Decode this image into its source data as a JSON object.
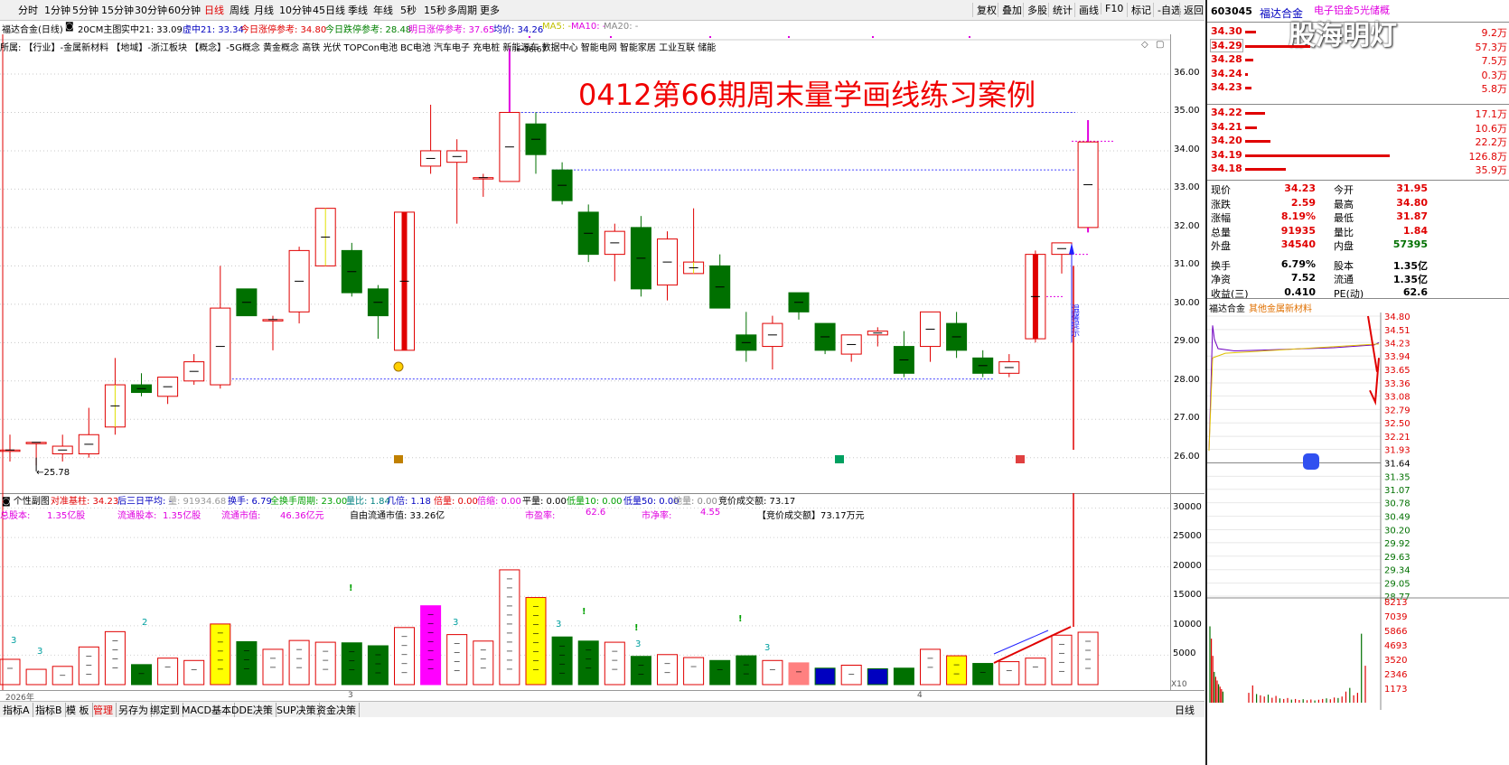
{
  "toolbar": {
    "periods": [
      "分时",
      "1分钟",
      "5分钟",
      "15分钟",
      "30分钟",
      "60分钟",
      "日线",
      "周线",
      "月线",
      "10分钟",
      "45日线",
      "季线",
      "年线",
      "5秒",
      "15秒",
      "多周期",
      "更多"
    ],
    "active": "日线",
    "right_buttons": [
      "复权",
      "叠加",
      "多股",
      "统计",
      "画线",
      "F10",
      "标记",
      "-自选",
      "返回"
    ]
  },
  "info": {
    "title": "福达合金(日线)",
    "main": "20CM主图",
    "shizhong": "实中21: 33.09",
    "xuzhong": "虚中21: 33.34",
    "today_limit": "今日涨停参考: 34.80",
    "today_down": "今日跌停参考: 28.48",
    "tomorrow_limit": "明日涨停参考: 37.65",
    "avg": "均价: 34.26",
    "ma5": "MA5: -",
    "ma10": "MA10: -",
    "ma20": "MA20: -"
  },
  "suoshu": "所属:   【行业】-金属新材料  【地域】-浙江板块    【概念】-5G概念 黄金概念 高铁 光伏 TOPCon电池 BC电池 汽车电子 充电桩 新能源车 数据中心 智能电网 智能家居 工业互联 储能",
  "overlay_title": "0412第66期周末量学画线练习案例",
  "annot": {
    "low": "25.78",
    "high": "36.67",
    "side_note": "温馨提示"
  },
  "axis_prices": [
    "36.00",
    "35.00",
    "34.00",
    "33.00",
    "32.00",
    "31.00",
    "30.00",
    "29.00",
    "28.00",
    "27.00",
    "26.00"
  ],
  "vol_axis": [
    "30000",
    "25000",
    "20000",
    "15000",
    "10000",
    "5000"
  ],
  "sub": {
    "name": "个性副图",
    "line1": [
      "对准基柱: 34.23",
      "后三日平均: -",
      "量: 91934.68",
      "换手: 6.79",
      "全换手周期: 23.00",
      "量比: 1.84",
      "几倍: 1.18",
      "倍量: 0.00",
      "倍缩: 0.00",
      "平量: 0.00",
      "低量10: 0.00",
      "低量50: 0.00",
      "地量: 0.00",
      "竞价成交额: 73.17"
    ],
    "line2": [
      "总股本:",
      "1.35亿股",
      "流通股本:",
      "1.35亿股",
      "流通市值:",
      "46.36亿元",
      "自由流通市值: 33.26亿",
      "市盈率:",
      "62.6",
      "市净率:",
      "4.55",
      "【竞价成交额】73.17万元"
    ]
  },
  "x_labels": [
    "2026年",
    "3",
    "4"
  ],
  "x_unit": "X10",
  "bottom_tabs": [
    "指标A",
    "指标B",
    "模 板",
    "管理",
    "另存为",
    "绑定到",
    "MACD基本",
    "DDE决策",
    "SUP决策",
    "资金决策"
  ],
  "bottom_right": "日线",
  "quote": {
    "code": "603045",
    "name": "福达合金",
    "tag": "电子铝金5光储概",
    "watermark": "股海明灯",
    "asks": [
      {
        "p": "34.30",
        "v": "9.2万"
      },
      {
        "p": "34.29",
        "v": "57.3万"
      },
      {
        "p": "34.28",
        "v": "7.5万"
      },
      {
        "p": "34.24",
        "v": "0.3万"
      },
      {
        "p": "34.23",
        "v": "5.8万"
      }
    ],
    "bids": [
      {
        "p": "34.22",
        "v": "17.1万"
      },
      {
        "p": "34.21",
        "v": "10.6万"
      },
      {
        "p": "34.20",
        "v": "22.2万"
      },
      {
        "p": "34.19",
        "v": "126.8万"
      },
      {
        "p": "34.18",
        "v": "35.9万"
      }
    ],
    "stats": [
      [
        "现价",
        "34.23",
        "今开",
        "31.95"
      ],
      [
        "涨跌",
        "2.59",
        "最高",
        "34.80"
      ],
      [
        "涨幅",
        "8.19%",
        "最低",
        "31.87"
      ],
      [
        "总量",
        "91935",
        "量比",
        "1.84"
      ],
      [
        "外盘",
        "34540",
        "内盘",
        "57395"
      ],
      [
        "换手",
        "6.79%",
        "股本",
        "1.35亿"
      ],
      [
        "净资",
        "7.52",
        "流通",
        "1.35亿"
      ],
      [
        "收益(三)",
        "0.410",
        "PE(动)",
        "62.6"
      ]
    ],
    "mini_title": "福达合金",
    "mini_sector": "其他金属新材料",
    "mini_prices": [
      "34.80",
      "34.51",
      "34.23",
      "33.94",
      "33.65",
      "33.36",
      "33.08",
      "32.79",
      "32.50",
      "32.21",
      "31.93",
      "31.64",
      "31.35",
      "31.07",
      "30.78",
      "30.49",
      "30.20",
      "29.92",
      "29.63",
      "29.34",
      "29.05",
      "28.77"
    ],
    "mini_vols": [
      "8213",
      "7039",
      "5866",
      "4693",
      "3520",
      "2346",
      "1173"
    ]
  },
  "chart_data": {
    "type": "candlestick",
    "title": "福达合金(日线)",
    "x": [
      1,
      2,
      3,
      4,
      5,
      6,
      7,
      8,
      9,
      10,
      11,
      12,
      13,
      14,
      15,
      16,
      17,
      18,
      19,
      20,
      21,
      22,
      23,
      24,
      25,
      26,
      27,
      28,
      29,
      30,
      31,
      32,
      33,
      34,
      35,
      36,
      37,
      38,
      39,
      40,
      41
    ],
    "ohlc": [
      [
        26.2,
        26.6,
        25.9,
        26.2
      ],
      [
        26.4,
        26.4,
        25.8,
        26.4
      ],
      [
        26.1,
        26.6,
        25.9,
        26.3
      ],
      [
        26.1,
        27.3,
        26.0,
        26.6
      ],
      [
        26.8,
        28.6,
        26.6,
        27.9
      ],
      [
        27.9,
        28.2,
        27.6,
        27.7
      ],
      [
        27.6,
        28.1,
        27.4,
        28.1
      ],
      [
        28.0,
        28.7,
        27.9,
        28.5
      ],
      [
        27.9,
        31.0,
        27.8,
        29.9
      ],
      [
        30.4,
        30.4,
        29.7,
        29.7
      ],
      [
        29.6,
        29.7,
        28.8,
        29.6
      ],
      [
        29.8,
        31.5,
        29.5,
        31.4
      ],
      [
        31.0,
        32.4,
        31.0,
        32.5
      ],
      [
        31.4,
        31.6,
        30.2,
        30.3
      ],
      [
        30.4,
        30.5,
        29.1,
        29.7
      ],
      [
        28.8,
        32.4,
        28.8,
        32.4
      ],
      [
        33.6,
        35.2,
        33.4,
        34.0
      ],
      [
        33.7,
        34.3,
        32.1,
        34.0
      ],
      [
        33.3,
        33.4,
        32.8,
        33.3
      ],
      [
        33.2,
        36.67,
        33.2,
        35.0
      ],
      [
        34.7,
        35.0,
        33.4,
        33.9
      ],
      [
        33.5,
        33.7,
        32.6,
        32.7
      ],
      [
        32.4,
        32.6,
        31.1,
        31.3
      ],
      [
        31.3,
        32.1,
        30.6,
        31.9
      ],
      [
        32.0,
        32.3,
        30.2,
        30.4
      ],
      [
        30.5,
        31.9,
        30.1,
        31.7
      ],
      [
        30.8,
        32.5,
        30.8,
        31.1
      ],
      [
        31.0,
        31.3,
        30.0,
        29.9
      ],
      [
        29.2,
        29.8,
        28.5,
        28.8
      ],
      [
        28.9,
        29.7,
        28.3,
        29.5
      ],
      [
        30.3,
        30.3,
        29.6,
        29.8
      ],
      [
        29.5,
        29.5,
        28.7,
        28.8
      ],
      [
        28.7,
        29.2,
        28.5,
        29.2
      ],
      [
        29.2,
        29.4,
        28.9,
        29.3
      ],
      [
        28.9,
        29.3,
        28.1,
        28.2
      ],
      [
        28.9,
        29.8,
        28.5,
        29.8
      ],
      [
        29.5,
        29.8,
        28.6,
        28.8
      ],
      [
        28.6,
        28.8,
        28.1,
        28.2
      ],
      [
        28.2,
        28.7,
        28.1,
        28.5
      ],
      [
        29.1,
        31.4,
        29.0,
        31.3
      ],
      [
        31.3,
        31.6,
        30.8,
        31.6
      ],
      [
        32.0,
        34.8,
        31.87,
        34.23
      ]
    ],
    "volume": [
      4300,
      2600,
      3100,
      6400,
      9000,
      3400,
      4500,
      4100,
      10300,
      7300,
      6000,
      7500,
      7200,
      7100,
      6600,
      9700,
      13400,
      8500,
      7400,
      19500,
      14800,
      8100,
      7400,
      7200,
      4800,
      5100,
      4600,
      4100,
      4900,
      4100,
      3700,
      2800,
      3300,
      2700,
      2800,
      6000,
      4900,
      3600,
      3900,
      4500,
      8400,
      8900
    ],
    "ylim": [
      25.5,
      36.8
    ],
    "vol_ylim": [
      0,
      31000
    ]
  }
}
